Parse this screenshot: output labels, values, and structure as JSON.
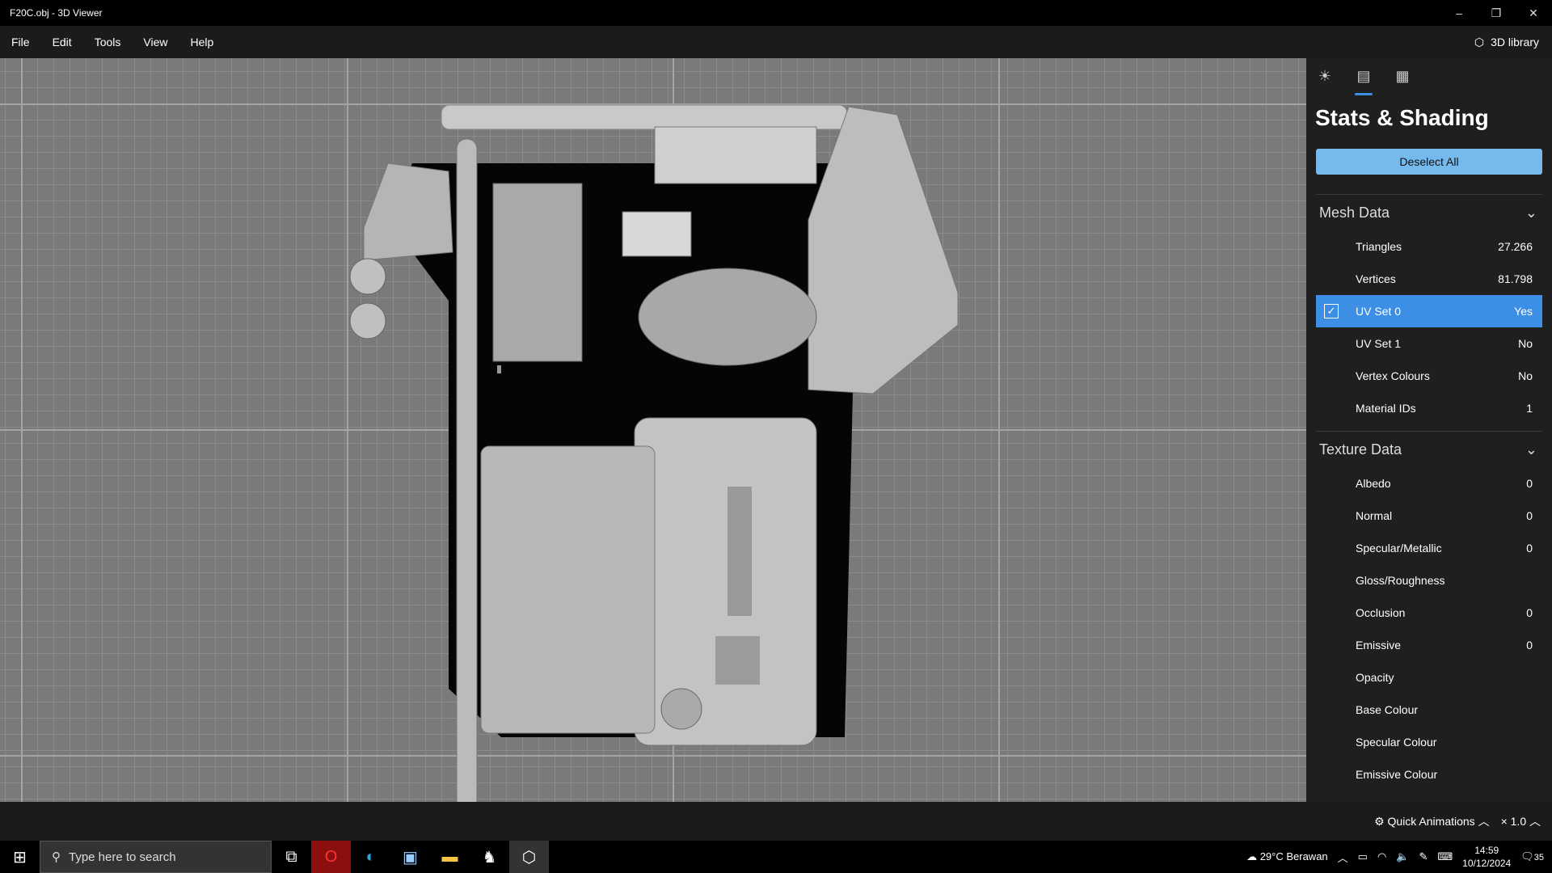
{
  "window": {
    "title": "F20C.obj - 3D Viewer",
    "minimize": "–",
    "restore": "❐",
    "close": "✕"
  },
  "menu": [
    "File",
    "Edit",
    "Tools",
    "View",
    "Help"
  ],
  "library_label": "3D library",
  "panel": {
    "tabs": [
      "lighting-tab",
      "stats-tab",
      "grid-tab"
    ],
    "title": "Stats & Shading",
    "deselect_label": "Deselect All",
    "mesh_header": "Mesh Data",
    "mesh_rows": [
      {
        "label": "Triangles",
        "value": "27.266"
      },
      {
        "label": "Vertices",
        "value": "81.798"
      },
      {
        "label": "UV Set 0",
        "value": "Yes",
        "checked": true
      },
      {
        "label": "UV Set 1",
        "value": "No"
      },
      {
        "label": "Vertex Colours",
        "value": "No"
      },
      {
        "label": "Material IDs",
        "value": "1"
      }
    ],
    "texture_header": "Texture Data",
    "texture_rows": [
      {
        "label": "Albedo",
        "value": "0"
      },
      {
        "label": "Normal",
        "value": "0"
      },
      {
        "label": "Specular/Metallic",
        "value": "0"
      },
      {
        "label": "Gloss/Roughness",
        "value": ""
      },
      {
        "label": "Occlusion",
        "value": "0"
      },
      {
        "label": "Emissive",
        "value": "0"
      },
      {
        "label": "Opacity",
        "value": ""
      },
      {
        "label": "Base Colour",
        "value": ""
      },
      {
        "label": "Specular Colour",
        "value": ""
      },
      {
        "label": "Emissive Colour",
        "value": ""
      }
    ],
    "accent": "#76b9ed",
    "selected_row": "#3d8fe6"
  },
  "bottom": {
    "animations": "Quick Animations",
    "speed": "× 1.0"
  },
  "taskbar": {
    "search_placeholder": "Type here to search",
    "weather": "29°C  Berawan",
    "time": "14:59",
    "date": "10/12/2024",
    "notifications": "35"
  }
}
